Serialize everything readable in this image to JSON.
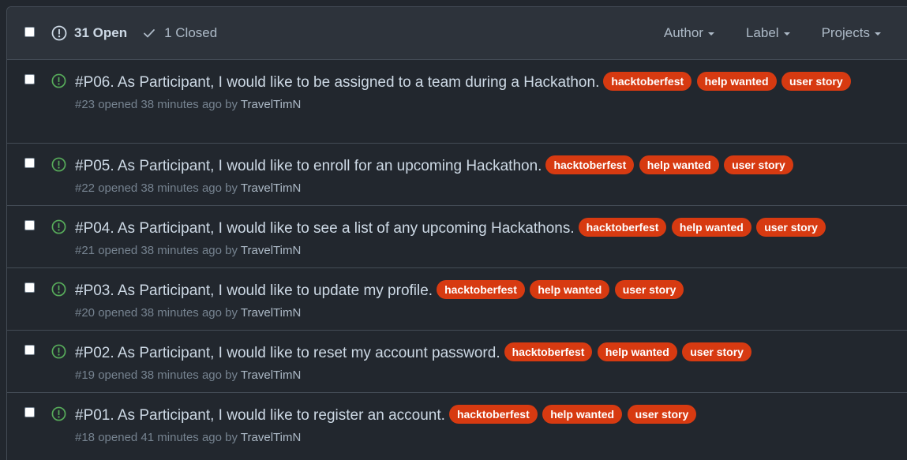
{
  "header": {
    "open_count": "31 Open",
    "closed_count": "1 Closed",
    "filters": [
      "Author",
      "Label",
      "Projects"
    ]
  },
  "label_color": "#d73a11",
  "issues": [
    {
      "title": "#P06. As Participant, I would like to be assigned to a team during a Hackathon.",
      "labels": [
        "hacktoberfest",
        "help wanted",
        "user story"
      ],
      "meta": {
        "number": "#23",
        "opened": " opened 38 minutes ago by ",
        "author": "TravelTimN"
      }
    },
    {
      "title": "#P05. As Participant, I would like to enroll for an upcoming Hackathon.",
      "labels": [
        "hacktoberfest",
        "help wanted",
        "user story"
      ],
      "meta": {
        "number": "#22",
        "opened": " opened 38 minutes ago by ",
        "author": "TravelTimN"
      }
    },
    {
      "title": "#P04. As Participant, I would like to see a list of any upcoming Hackathons.",
      "labels": [
        "hacktoberfest",
        "help wanted",
        "user story"
      ],
      "meta": {
        "number": "#21",
        "opened": " opened 38 minutes ago by ",
        "author": "TravelTimN"
      }
    },
    {
      "title": "#P03. As Participant, I would like to update my profile.",
      "labels": [
        "hacktoberfest",
        "help wanted",
        "user story"
      ],
      "meta": {
        "number": "#20",
        "opened": " opened 38 minutes ago by ",
        "author": "TravelTimN"
      }
    },
    {
      "title": "#P02. As Participant, I would like to reset my account password.",
      "labels": [
        "hacktoberfest",
        "help wanted",
        "user story"
      ],
      "meta": {
        "number": "#19",
        "opened": " opened 38 minutes ago by ",
        "author": "TravelTimN"
      }
    },
    {
      "title": "#P01. As Participant, I would like to register an account.",
      "labels": [
        "hacktoberfest",
        "help wanted",
        "user story"
      ],
      "meta": {
        "number": "#18",
        "opened": " opened 41 minutes ago by ",
        "author": "TravelTimN"
      }
    }
  ]
}
